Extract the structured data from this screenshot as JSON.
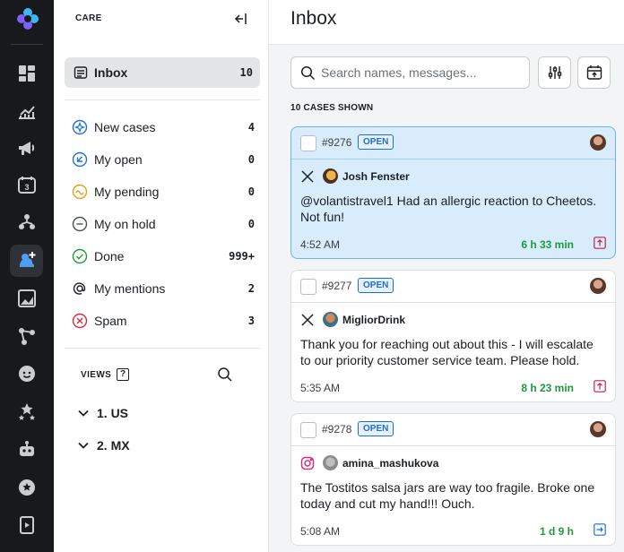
{
  "rail": {
    "icons": [
      "logo-icon",
      "dashboard-icon",
      "reports-icon",
      "megaphone-icon",
      "calendar-icon",
      "org-chart-icon",
      "care-icon",
      "image-icon",
      "nodes-icon",
      "smile-badge-icon",
      "stars-icon",
      "bot-icon",
      "chat-star-icon",
      "video-icon"
    ],
    "calendar_day": "3"
  },
  "sidebar": {
    "header": "CARE",
    "inbox": {
      "label": "Inbox",
      "count": "10"
    },
    "items": [
      {
        "label": "New cases",
        "count": "4",
        "icon": "new-cases-icon"
      },
      {
        "label": "My open",
        "count": "0",
        "icon": "my-open-icon"
      },
      {
        "label": "My pending",
        "count": "0",
        "icon": "my-pending-icon"
      },
      {
        "label": "My on hold",
        "count": "0",
        "icon": "my-on-hold-icon"
      },
      {
        "label": "Done",
        "count": "999+",
        "icon": "done-icon"
      },
      {
        "label": "My mentions",
        "count": "2",
        "icon": "mentions-icon"
      },
      {
        "label": "Spam",
        "count": "3",
        "icon": "spam-icon"
      }
    ],
    "views_label": "VIEWS",
    "help": "?",
    "views": [
      {
        "label": "1. US"
      },
      {
        "label": "2. MX"
      }
    ]
  },
  "main": {
    "title": "Inbox",
    "search_placeholder": "Search names, messages...",
    "cases_shown": "10 CASES SHOWN",
    "cards": [
      {
        "id": "#9276",
        "status": "OPEN",
        "network": "x",
        "user": "Josh Fenster",
        "message": "@volantistravel1 Had an allergic reaction to Cheetos. Not fun!",
        "time": "4:52 AM",
        "age": "6 h 33 min",
        "action": "escalate",
        "selected": true
      },
      {
        "id": "#9277",
        "status": "OPEN",
        "network": "x",
        "user": "MigliorDrink",
        "message": "Thank you for reaching out about this - I will escalate to our priority customer service team. Please hold.",
        "time": "5:35 AM",
        "age": "8 h 23 min",
        "action": "escalate",
        "selected": false
      },
      {
        "id": "#9278",
        "status": "OPEN",
        "network": "instagram",
        "user": "amina_mashukova",
        "message": "The Tostitos salsa jars are way too fragile. Broke one today and cut my hand!!! Ouch.",
        "time": "5:08 AM",
        "age": "1 d 9 h",
        "action": "assign",
        "selected": false
      }
    ]
  },
  "colors": {
    "rail_bg": "#17191c",
    "accent": "#1f6fd0",
    "selected_card": "#d8ecfb",
    "age_green": "#1e9a3c",
    "escalate_red": "#c0234e"
  }
}
